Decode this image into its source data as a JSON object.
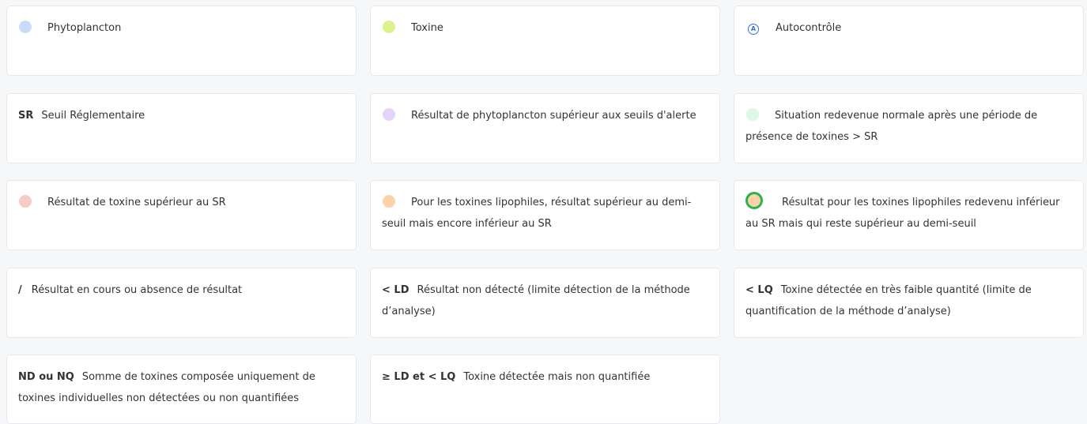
{
  "legend": [
    {
      "label": "Phytoplancton",
      "marker": "dot",
      "color": "#c6dcf8"
    },
    {
      "label": "Toxine",
      "marker": "dot",
      "color": "#dcf28e"
    },
    {
      "label": "Autocontrôle",
      "marker": "badge",
      "badge_text": "A",
      "color": "#3a6fd8"
    },
    {
      "code": "SR",
      "label": "Seuil Réglementaire"
    },
    {
      "label": "Résultat de phytoplancton supérieur aux seuils d'alerte",
      "marker": "dot",
      "color": "#e5d4f7"
    },
    {
      "label": "Situation redevenue normale après une période de présence de toxines > SR",
      "marker": "dot",
      "color": "#dcf7e4"
    },
    {
      "label": "Résultat de toxine supérieur au SR",
      "marker": "dot",
      "color": "#f8cbcb"
    },
    {
      "label": "Pour les toxines lipophiles, résultat supérieur au demi-seuil mais encore inférieur au SR",
      "marker": "dot",
      "color": "#fad3a8"
    },
    {
      "label": "Résultat pour les toxines lipophiles redevenu inférieur au SR mais qui reste supérieur au demi-seuil",
      "marker": "ring-dot",
      "color": "#fad3a8",
      "ring_color": "#2eb24f"
    },
    {
      "code": "/",
      "label": "Résultat en cours ou absence de résultat"
    },
    {
      "code": "< LD",
      "label": "Résultat non détecté (limite détection de la méthode d’analyse)"
    },
    {
      "code": "< LQ",
      "label": "Toxine détectée en très faible quantité (limite de quantification de la méthode d’analyse)"
    },
    {
      "code": "ND ou NQ",
      "label": "Somme de toxines composée uniquement de toxines individuelles non détectées ou non quantifiées"
    },
    {
      "code": "≥ LD et < LQ",
      "label": "Toxine détectée mais non quantifiée"
    }
  ]
}
